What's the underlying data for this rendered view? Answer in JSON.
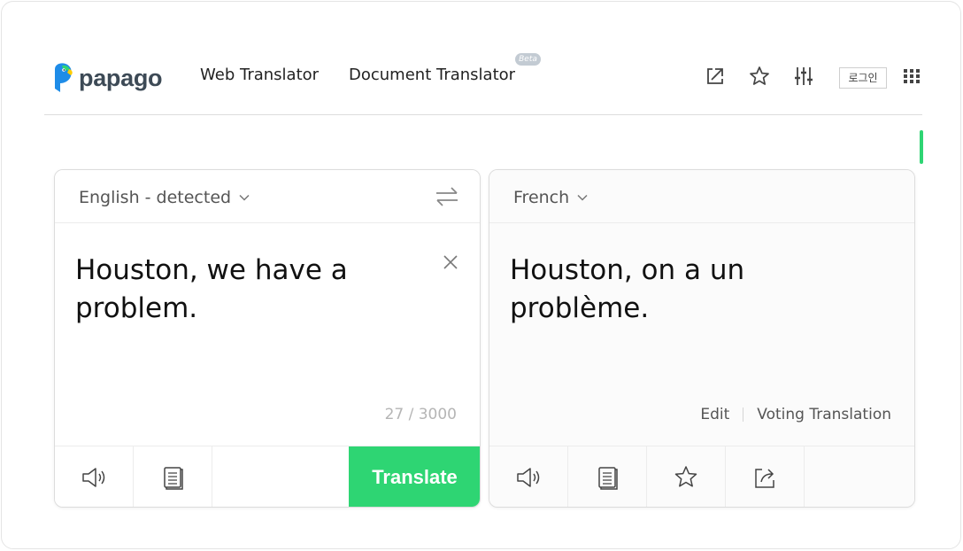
{
  "header": {
    "logo_text": "papago",
    "nav": {
      "web": "Web Translator",
      "document": "Document Translator"
    },
    "beta_badge": "Beta",
    "login_label": "로그인",
    "icons": [
      "external-link-icon",
      "star-icon",
      "settings-sliders-icon",
      "apps-grid-icon"
    ]
  },
  "source": {
    "language": "English - detected",
    "text": "Houston, we have a problem.",
    "char_count": "27 / 3000",
    "translate_label": "Translate",
    "tools": [
      "speaker-icon",
      "document-icon"
    ]
  },
  "target": {
    "language": "French",
    "text": "Houston, on a un problème.",
    "edit_label": "Edit",
    "voting_label": "Voting Translation",
    "tools": [
      "speaker-icon",
      "document-icon",
      "star-icon",
      "share-icon"
    ]
  },
  "colors": {
    "accent": "#2ed573",
    "logo_blue": "#1e8ce8",
    "logo_text": "#3d4a56"
  }
}
